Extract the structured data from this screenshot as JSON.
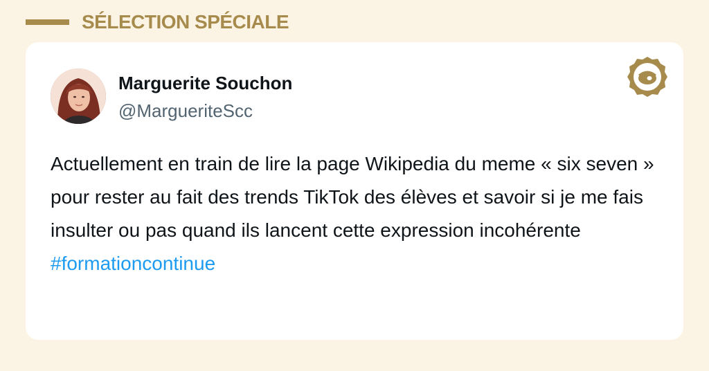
{
  "header": {
    "title": "SÉLECTION SPÉCIALE"
  },
  "tweet": {
    "author_name": "Marguerite Souchon",
    "author_handle": "@MargueriteScc",
    "text": "Actuellement en train de lire la page Wikipedia du meme « six seven » pour rester au fait des trends TikTok des élèves et savoir si je me fais insulter ou pas quand ils lancent cette expression incohérente",
    "hashtag": "#formationcontinue",
    "avatar_icon": "avatar-photo",
    "brand_icon": "seal-logo-icon"
  },
  "colors": {
    "background": "#fbf3e3",
    "accent_gold": "#a68b4d",
    "hashtag_blue": "#1d9bf0",
    "handle_gray": "#536471",
    "text_dark": "#0f1419"
  }
}
